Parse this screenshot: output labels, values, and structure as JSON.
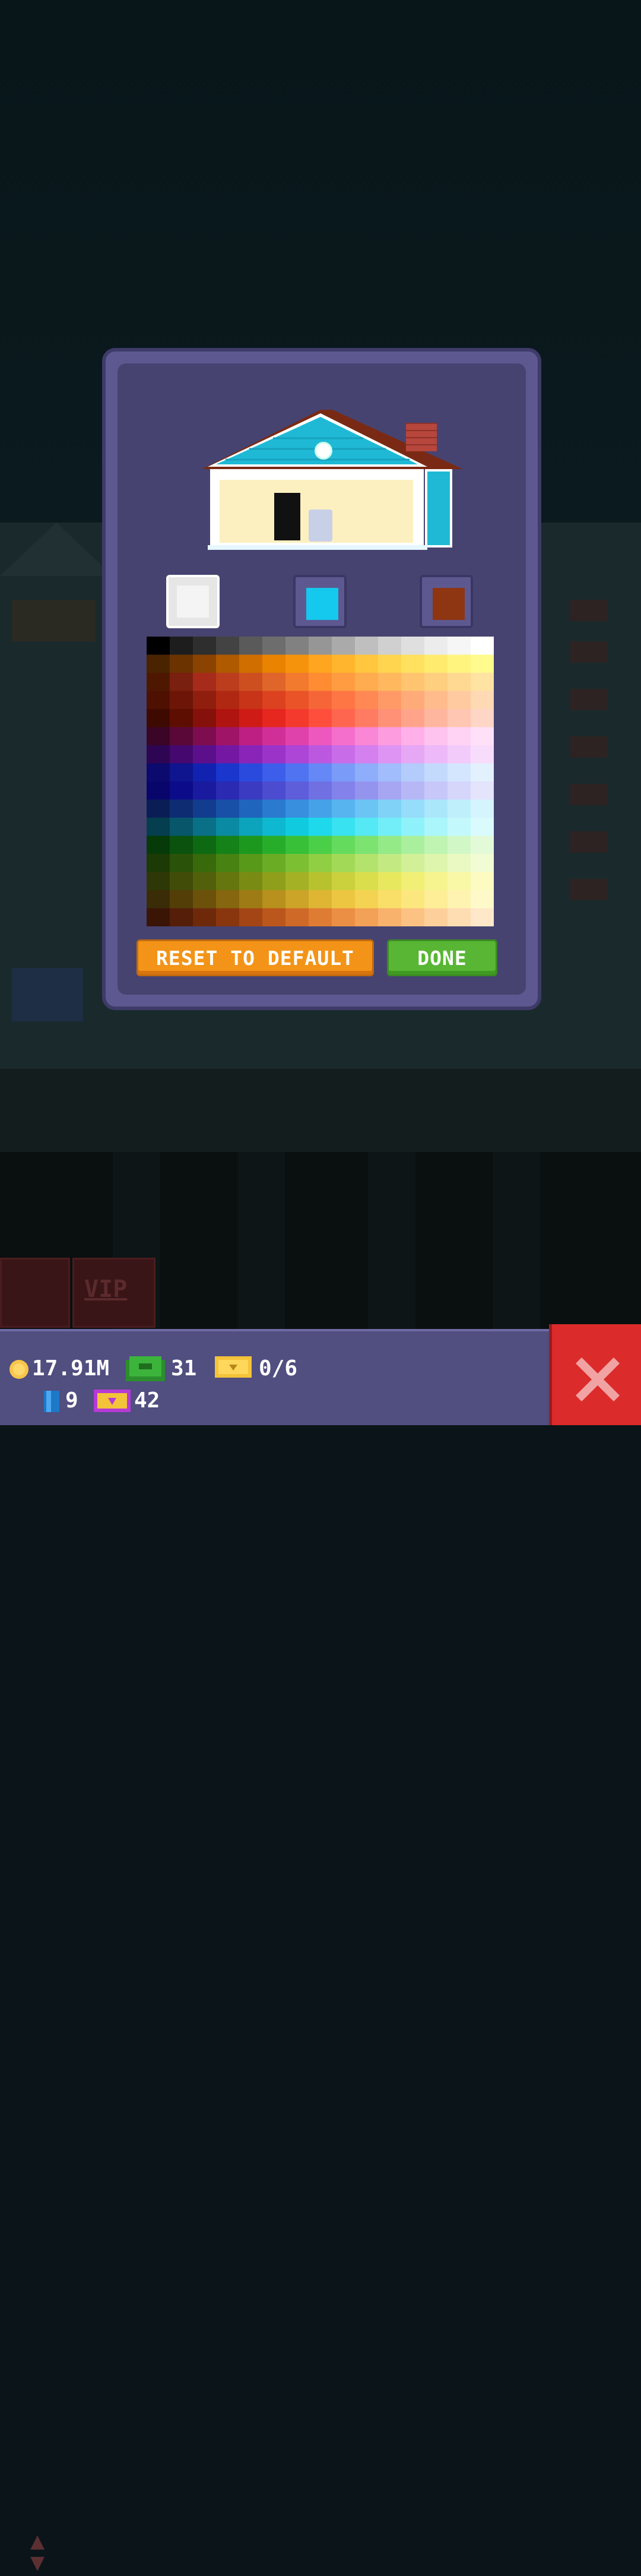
{
  "background": {
    "vip_label": "VIP",
    "updown_icon": "up-down-arrows-icon"
  },
  "dialog": {
    "color_slots": [
      {
        "name": "white",
        "color": "#f4f4f4",
        "selected": true
      },
      {
        "name": "blue",
        "color": "#15c8ee",
        "selected": false
      },
      {
        "name": "brown",
        "color": "#8e3512",
        "selected": false
      }
    ],
    "palette": {
      "rows": [
        [
          "#000000",
          "#1d1d1d",
          "#2e2e2e",
          "#434343",
          "#5a5a5a",
          "#6d6d6d",
          "#818181",
          "#969696",
          "#aaaaaa",
          "#bfbfbf",
          "#d0d0d0",
          "#dfdfdf",
          "#ececec",
          "#f6f6f6",
          "#ffffff"
        ],
        [
          "#4a2300",
          "#6a3300",
          "#8a4300",
          "#b05a00",
          "#d06e00",
          "#e98300",
          "#f6930c",
          "#ffa51f",
          "#ffb52d",
          "#ffc63e",
          "#ffd44f",
          "#ffe15f",
          "#ffec6f",
          "#fff47e",
          "#fffb8d"
        ],
        [
          "#4e1800",
          "#7a2010",
          "#a62b1a",
          "#bb3d1d",
          "#cd4f20",
          "#e0652a",
          "#f27a2f",
          "#ff8c32",
          "#ff9c42",
          "#ffab4f",
          "#ffb85e",
          "#ffc46f",
          "#ffcf80",
          "#ffd991",
          "#ffe3a3"
        ],
        [
          "#4e1000",
          "#6d1608",
          "#8f1e0e",
          "#b02812",
          "#c83418",
          "#dd4220",
          "#ea5328",
          "#f66538",
          "#ff7645",
          "#ff8854",
          "#ff9a66",
          "#ffab79",
          "#ffbb8c",
          "#ffcaa0",
          "#ffd8b4"
        ],
        [
          "#3e0a00",
          "#5e0e00",
          "#86100a",
          "#b01410",
          "#cf1b16",
          "#e5271f",
          "#f33a2c",
          "#ff4f3c",
          "#ff664f",
          "#ff7c63",
          "#ff9177",
          "#ffa48b",
          "#ffb69f",
          "#ffc6b2",
          "#ffd5c5"
        ],
        [
          "#3a0526",
          "#5a0838",
          "#7d0d4f",
          "#a01468",
          "#bd1f82",
          "#d12f98",
          "#e042ac",
          "#ec58bd",
          "#f46fcb",
          "#fa86d6",
          "#fe9ce0",
          "#ffb0e8",
          "#ffc3ef",
          "#ffd3f4",
          "#ffe0f8"
        ],
        [
          "#2e0552",
          "#44086e",
          "#5c0f8a",
          "#7418a3",
          "#8a24b8",
          "#9c33c9",
          "#ad45d6",
          "#bc58e0",
          "#c96ce8",
          "#d480ee",
          "#de94f2",
          "#e6a7f5",
          "#edb9f8",
          "#f3cbfa",
          "#f8dcfc"
        ],
        [
          "#0c0a6e",
          "#0f148f",
          "#1222b0",
          "#1a36cc",
          "#2a4ade",
          "#3c5eea",
          "#5073f2",
          "#6588f6",
          "#7a9bf8",
          "#8eadfa",
          "#a1bdfb",
          "#b3ccfc",
          "#c4dafd",
          "#d4e6fe",
          "#e3f0fe"
        ],
        [
          "#08066b",
          "#0c0c8a",
          "#1a1a9e",
          "#2a2ab2",
          "#3b3bc2",
          "#4c4cd0",
          "#5e5edb",
          "#7070e3",
          "#8282ea",
          "#9494ef",
          "#a6a6f3",
          "#b7b7f6",
          "#c7c7f9",
          "#d6d6fb",
          "#e4e4fd"
        ],
        [
          "#0a1e55",
          "#0e2c72",
          "#123c8e",
          "#1850a8",
          "#1f65be",
          "#2a7ad0",
          "#378fde",
          "#46a2e8",
          "#58b4ef",
          "#6bc4f4",
          "#80d2f7",
          "#95ddfa",
          "#abe7fb",
          "#c0effc",
          "#d4f5fd"
        ],
        [
          "#053e4e",
          "#07566a",
          "#097088",
          "#0b8aa3",
          "#0ca3bc",
          "#0db8d0",
          "#10cbe0",
          "#1ed9eb",
          "#38e2f1",
          "#55e9f5",
          "#72eef8",
          "#8ff2fa",
          "#aaf6fb",
          "#c3f9fc",
          "#d9fbfd"
        ],
        [
          "#063a08",
          "#0a520d",
          "#0e6a12",
          "#148218",
          "#1c981f",
          "#28ad2a",
          "#37c038",
          "#4ccf48",
          "#64db5c",
          "#7ce371",
          "#94ea87",
          "#aaef9d",
          "#bff4b2",
          "#d2f7c6",
          "#e3fad9"
        ],
        [
          "#1c3a05",
          "#2a5208",
          "#386a0c",
          "#478212",
          "#58991a",
          "#6aad25",
          "#7dbf33",
          "#90ce44",
          "#a2da57",
          "#b3e36c",
          "#c3ea82",
          "#d1f098",
          "#def5ad",
          "#e9f9c1",
          "#f2fcd4"
        ],
        [
          "#2e3806",
          "#404c08",
          "#52600b",
          "#66760f",
          "#7a8b14",
          "#8f9f1b",
          "#a4b124",
          "#b8c22f",
          "#cad13d",
          "#dadd4c",
          "#e8e85f",
          "#f1ef76",
          "#f6f48e",
          "#f9f8a7",
          "#fcfbc1"
        ],
        [
          "#3a2c06",
          "#533e08",
          "#6c510b",
          "#86660f",
          "#9f7b15",
          "#b7901d",
          "#cca427",
          "#deb633",
          "#ecc641",
          "#f4d353",
          "#f9de68",
          "#fce77f",
          "#fdee97",
          "#fef3b0",
          "#fff8c8"
        ],
        [
          "#3a1506",
          "#541e08",
          "#6e290b",
          "#89360f",
          "#a34515",
          "#bb561d",
          "#cf6927",
          "#df7c34",
          "#eb8f44",
          "#f3a157",
          "#f8b26c",
          "#fbc283",
          "#fdd09b",
          "#feddb3",
          "#ffe8ca"
        ]
      ]
    },
    "reset_label": "RESET TO DEFAULT",
    "done_label": "DONE"
  },
  "hud": {
    "coins": "17.91M",
    "bux": "31",
    "tickets": "0/6",
    "blue_items": "9",
    "golden_tickets": "42"
  },
  "colors": {
    "dialog_outer": "#5d5990",
    "dialog_inner": "#464371",
    "reset_button": "#f39418",
    "done_button": "#58b634",
    "close_button": "#dc2b2b",
    "hud_bg": "#514e80"
  }
}
